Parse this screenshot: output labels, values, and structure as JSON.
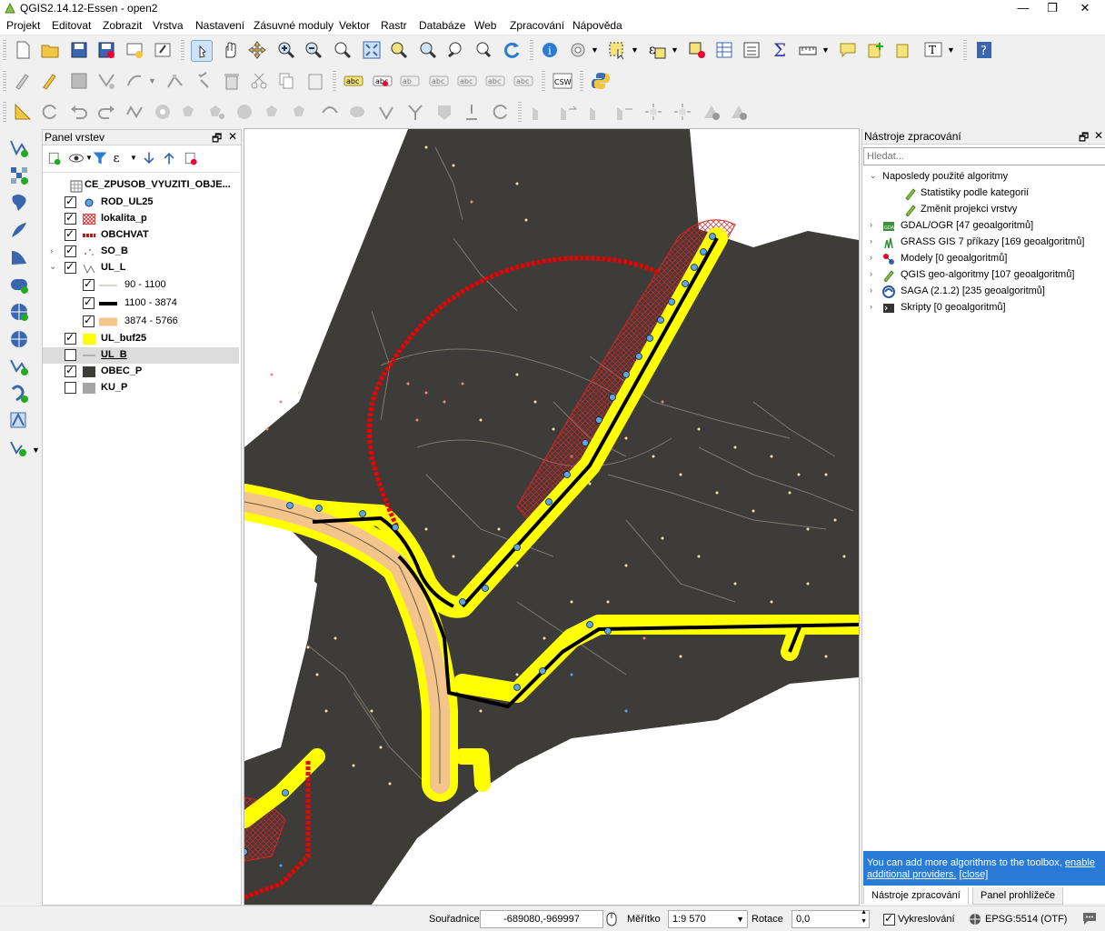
{
  "window": {
    "title": "QGIS2.14.12-Essen - open2"
  },
  "menu": [
    "Projekt",
    "Editovat",
    "Zobrazit",
    "Vrstva",
    "Nastavení",
    "Zásuvné moduly",
    "Vektor",
    "Rastr",
    "Databáze",
    "Web",
    "Zpracování",
    "Nápověda"
  ],
  "layers_panel": {
    "title": "Panel vrstev",
    "layers": [
      {
        "name": "CE_ZPUSOB_VYUZITI_OBJE...",
        "checked": null,
        "symbol": "raster"
      },
      {
        "name": "ROD_UL25",
        "checked": true,
        "symbol": "point-blue"
      },
      {
        "name": "lokalita_p",
        "checked": true,
        "symbol": "hatch-red"
      },
      {
        "name": "OBCHVAT",
        "checked": true,
        "symbol": "dashed-red"
      },
      {
        "name": "SO_B",
        "checked": false,
        "symbol": "points-small",
        "collapsed": true
      },
      {
        "name": "UL_L",
        "checked": true,
        "symbol": "line-cat",
        "expanded": true
      },
      {
        "name": "90 - 1100",
        "checked": true,
        "symbol": "thin-line",
        "sub": true
      },
      {
        "name": "1100 - 3874",
        "checked": true,
        "symbol": "thick-black",
        "sub": true
      },
      {
        "name": "3874 - 5766",
        "checked": true,
        "symbol": "tan-fill",
        "sub": true
      },
      {
        "name": "UL_buf25",
        "checked": true,
        "symbol": "yellow-fill"
      },
      {
        "name": "UL_B",
        "checked": false,
        "symbol": "grey-line",
        "selected": true
      },
      {
        "name": "OBEC_P",
        "checked": true,
        "symbol": "dark-fill"
      },
      {
        "name": "KU_P",
        "checked": false,
        "symbol": "grey-fill"
      }
    ]
  },
  "processing_panel": {
    "title": "Nástroje zpracování",
    "search_placeholder": "Hledat...",
    "recent_group": "Naposledy použité algoritmy",
    "recent": [
      "Statistiky podle kategorií",
      "Změnit projekci vrstvy"
    ],
    "providers": [
      {
        "label": "GDAL/OGR [47 geoalgoritmů]",
        "icon": "gdal-icon"
      },
      {
        "label": "GRASS GIS 7 příkazy [169 geoalgoritmů]",
        "icon": "grass-icon"
      },
      {
        "label": "Modely [0 geoalgoritmů]",
        "icon": "models-icon"
      },
      {
        "label": "QGIS geo-algoritmy [107 geoalgoritmů]",
        "icon": "qgis-icon"
      },
      {
        "label": "SAGA (2.1.2) [235 geoalgoritmů]",
        "icon": "saga-icon"
      },
      {
        "label": "Skripty [0 geoalgoritmů]",
        "icon": "scripts-icon"
      }
    ],
    "info_text": "You can add more algorithms to the toolbox,",
    "info_link": "enable additional providers.",
    "info_close": "[close]",
    "tabs": [
      "Nástroje zpracování",
      "Panel prohlížeče"
    ]
  },
  "statusbar": {
    "coord_label": "Souřadnice",
    "coord_value": "-689080,-969997",
    "scale_label": "Měřítko",
    "scale_value": "1:9 570",
    "rotation_label": "Rotace",
    "rotation_value": "0,0",
    "render_label": "Vykreslování",
    "crs": "EPSG:5514 (OTF)"
  },
  "colors": {
    "accent": "#2a7bd6",
    "map_area": "#3e3c38",
    "buffer": "#ffff00",
    "road": "#000000",
    "bypass": "#e00000"
  }
}
